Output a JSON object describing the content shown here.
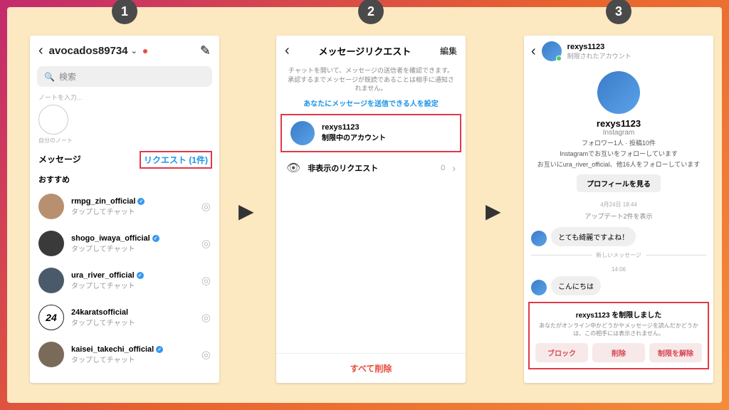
{
  "steps": [
    "1",
    "2",
    "3"
  ],
  "p1": {
    "username": "avocados89734",
    "search_placeholder": "検索",
    "note_input": "ノートを入力...",
    "note_self": "自分のノート",
    "messages_label": "メッセージ",
    "requests_link": "リクエスト (1件)",
    "suggest_label": "おすすめ",
    "tap_chat": "タップしてチャット",
    "items": [
      {
        "name": "rmpg_zin_official",
        "verified": true,
        "av": "av1"
      },
      {
        "name": "shogo_iwaya_official",
        "verified": true,
        "av": "av2"
      },
      {
        "name": "ura_river_official",
        "verified": true,
        "av": "av3"
      },
      {
        "name": "24karatsofficial",
        "verified": false,
        "av": "av4",
        "txt": "24"
      },
      {
        "name": "kaisei_takechi_official",
        "verified": true,
        "av": "av5"
      }
    ]
  },
  "p2": {
    "title": "メッセージリクエスト",
    "edit": "編集",
    "desc": "チャットを開いて、メッセージの送信者を確認できます。承認するまでメッセージが既読であることは相手に通知されません。",
    "link": "あなたにメッセージを送信できる人を設定",
    "req_name": "rexys1123",
    "req_sub": "制限中のアカウント",
    "hidden_label": "非表示のリクエスト",
    "hidden_count": "0",
    "delete_all": "すべて削除"
  },
  "p3": {
    "username": "rexys1123",
    "restricted": "制限されたアカウント",
    "ig": "Instagram",
    "stats": "フォロワー1人 · 投稿10件",
    "mutual1": "Instagramでお互いをフォローしています",
    "mutual2": "お互いにura_river_official、他16人をフォローしています",
    "profile_btn": "プロフィールを見る",
    "timestamp1": "4月24日 18:44",
    "updates": "アップデート2件を表示",
    "msg1": "とても綺麗ですよね！",
    "new_msg": "新しいメッセージ",
    "timestamp2": "14:06",
    "msg2": "こんにちは",
    "restrict_title": "rexys1123 を制限しました",
    "restrict_desc": "あなたがオンライン中かどうかやメッセージを読んだかどうかは、この相手には表示されません。",
    "btn_block": "ブロック",
    "btn_delete": "削除",
    "btn_unrestrict": "制限を解除"
  }
}
